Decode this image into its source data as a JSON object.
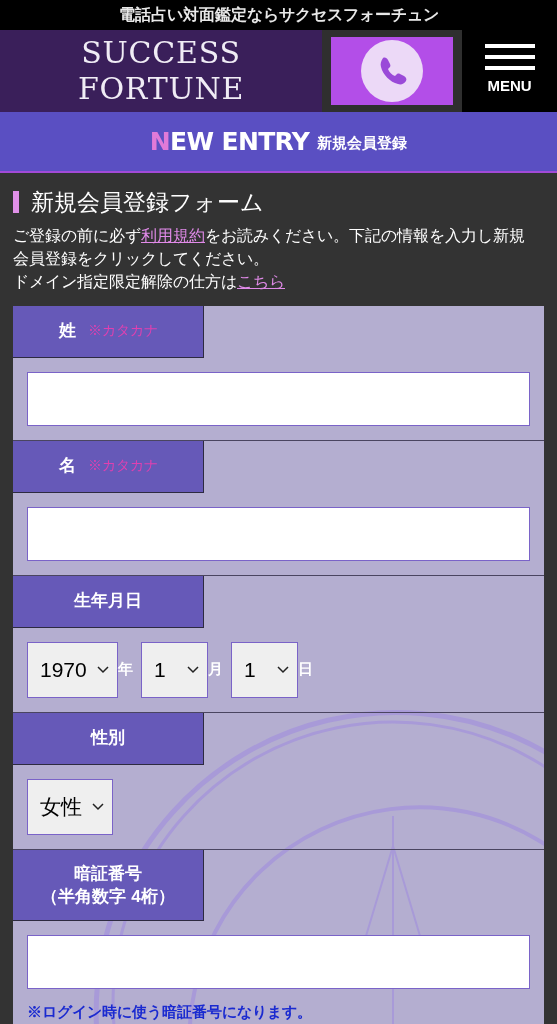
{
  "top_bar": {
    "text": "電話占い対面鑑定ならサクセスフォーチュン"
  },
  "header": {
    "logo_lines": [
      "SUCCESS",
      "FORTUNE"
    ],
    "menu_label": "MENU"
  },
  "banner": {
    "accent": "N",
    "title": "EW ENTRY",
    "subtitle": "新規会員登録"
  },
  "form_title": "新規会員登録フォーム",
  "intro": {
    "before": "ご登録の前に必ず",
    "link": "利用規約",
    "after": "をお読みください。下記の情報を入力し新規会員登録をクリックしてください。",
    "line2": "ドメイン指定限定解除の仕方は",
    "link2": "こちら"
  },
  "fields": [
    {
      "kind": "text",
      "label": "姓",
      "hint": "※カタカナ"
    },
    {
      "kind": "text",
      "label": "名",
      "hint": "※カタカナ"
    },
    {
      "kind": "date",
      "label": "生年月日",
      "selects": [
        {
          "value": "1970",
          "unit": "年"
        },
        {
          "value": "1",
          "unit": "月"
        },
        {
          "value": "1",
          "unit": "日"
        }
      ]
    },
    {
      "kind": "select",
      "label": "性別",
      "selects": [
        {
          "value": "女性"
        }
      ]
    },
    {
      "kind": "text",
      "label": "暗証番号",
      "label2": "（半角数字 4桁）",
      "note": "※ログイン時に使う暗証番号になります。"
    }
  ]
}
